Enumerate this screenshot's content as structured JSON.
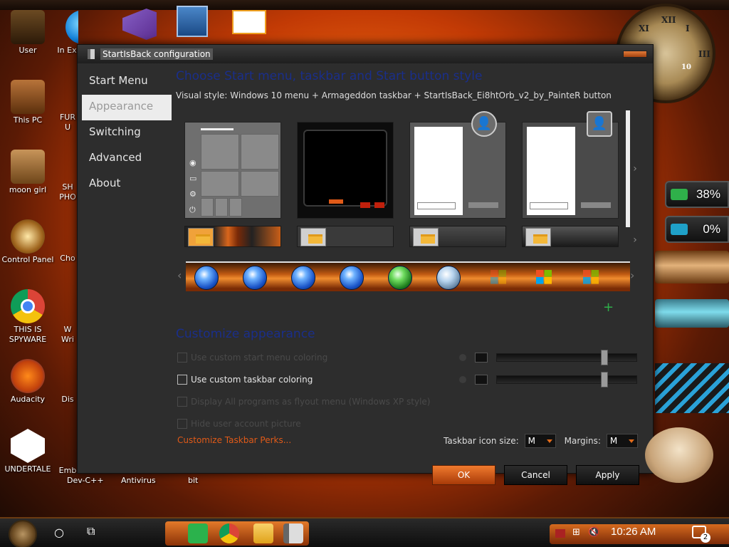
{
  "window": {
    "title": "StartIsBack configuration"
  },
  "sidebar": {
    "items": [
      {
        "label": "Start Menu"
      },
      {
        "label": "Appearance"
      },
      {
        "label": "Switching"
      },
      {
        "label": "Advanced"
      },
      {
        "label": "About"
      }
    ],
    "active_index": 1
  },
  "appearance": {
    "heading": "Choose Start menu, taskbar and Start button style",
    "visual_style_label": "Visual style:",
    "visual_style_value": "Windows 10 menu + Armageddon taskbar + StartIsBack_Ei8htOrb_v2_by_PainteR button",
    "customize_heading": "Customize appearance",
    "options": [
      {
        "label": "Use custom start menu coloring",
        "enabled": false,
        "checked": false
      },
      {
        "label": "Use custom taskbar coloring",
        "enabled": true,
        "checked": false
      },
      {
        "label": "Display All programs as flyout menu (Windows XP style)",
        "enabled": false,
        "checked": false
      },
      {
        "label": "Hide user account picture",
        "enabled": false,
        "checked": false
      }
    ],
    "perks_link": "Customize Taskbar Perks...",
    "taskbar_icon_size_label": "Taskbar icon size:",
    "taskbar_icon_size_value": "M",
    "margins_label": "Margins:",
    "margins_value": "M"
  },
  "buttons": {
    "ok": "OK",
    "cancel": "Cancel",
    "apply": "Apply"
  },
  "desktop_icons": [
    {
      "label": "User"
    },
    {
      "label": "This PC"
    },
    {
      "label": "moon girl"
    },
    {
      "label": "Control Panel"
    },
    {
      "label": "THIS IS SPYWARE"
    },
    {
      "label": "Audacity"
    },
    {
      "label": "UNDERTALE"
    }
  ],
  "desktop_partial_labels": [
    {
      "label": "In Ex"
    },
    {
      "label": "FUR U"
    },
    {
      "label": "SH PHO"
    },
    {
      "label": "Cho"
    },
    {
      "label": "W Wri"
    },
    {
      "label": "Dis"
    },
    {
      "label": "Emb"
    }
  ],
  "bottom_labels": [
    {
      "label": "Dev-C++"
    },
    {
      "label": "Antivirus"
    },
    {
      "label": "bit"
    }
  ],
  "gauges": [
    {
      "value": "38%",
      "color": "#2fb04a"
    },
    {
      "value": "0%",
      "color": "#1fa1c8"
    }
  ],
  "clock_numerals": [
    "XII",
    "I",
    "XI",
    "III"
  ],
  "clock_center": "10",
  "taskbar": {
    "time": "10:26 AM",
    "notification_count": "2",
    "accent": "#e37a2a"
  }
}
